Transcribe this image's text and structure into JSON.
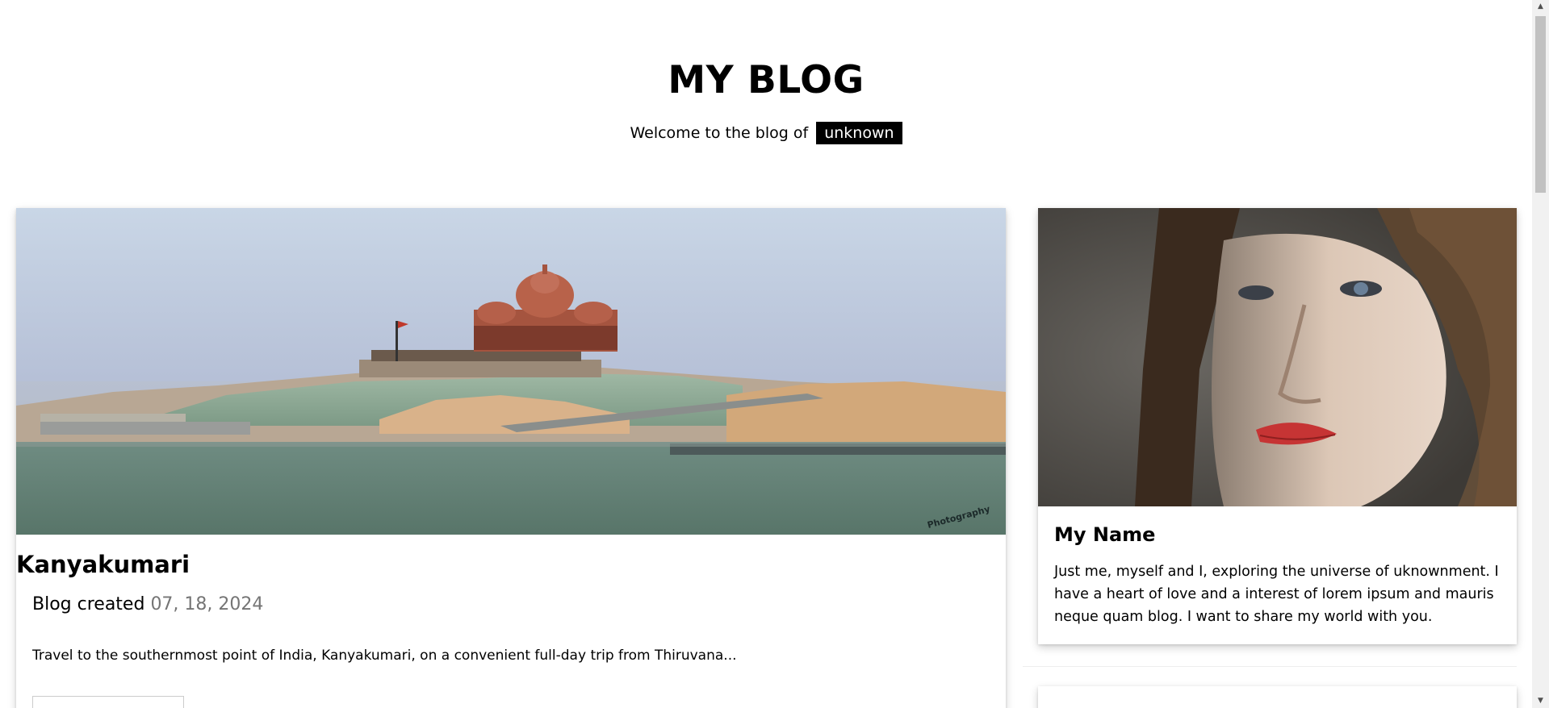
{
  "header": {
    "title": "MY BLOG",
    "tagline_prefix": "Welcome to the blog of",
    "tagline_name": "unknown"
  },
  "post": {
    "title": "Kanyakumari",
    "created_label": "Blog created",
    "date": "07, 18, 2024",
    "excerpt": "Travel to the southernmost point of India, Kanyakumari, on a convenient full-day trip from Thiruvana...",
    "image_watermark": "Photography"
  },
  "profile": {
    "name": "My Name",
    "bio": "Just me, myself and I, exploring the universe of uknownment. I have a heart of love and a interest of lorem ipsum and mauris neque quam blog. I want to share my world with you."
  },
  "colors": {
    "accent_tag_bg": "#000000",
    "date_gray": "#757575",
    "scrollbar_track": "#f1f1f1",
    "scrollbar_thumb": "#c1c1c1"
  },
  "icons": {
    "scroll_up": "▲",
    "scroll_down": "▼"
  }
}
